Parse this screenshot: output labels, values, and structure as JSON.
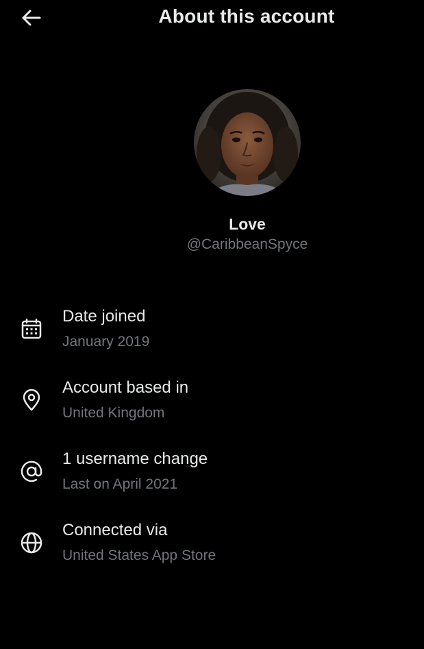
{
  "header": {
    "title": "About this account",
    "back_icon": "arrow-left-icon"
  },
  "profile": {
    "display_name": "Love",
    "handle": "@CaribbeanSpyce"
  },
  "info": [
    {
      "icon": "calendar-icon",
      "title": "Date joined",
      "value": "January 2019"
    },
    {
      "icon": "location-pin-icon",
      "title": "Account based in",
      "value": "United Kingdom"
    },
    {
      "icon": "at-sign-icon",
      "title": "1 username change",
      "value": "Last on April 2021"
    },
    {
      "icon": "globe-icon",
      "title": "Connected via",
      "value": "United States App Store"
    }
  ],
  "colors": {
    "background": "#000000",
    "primary_text": "#e7e9ea",
    "secondary_text": "#71767b"
  }
}
